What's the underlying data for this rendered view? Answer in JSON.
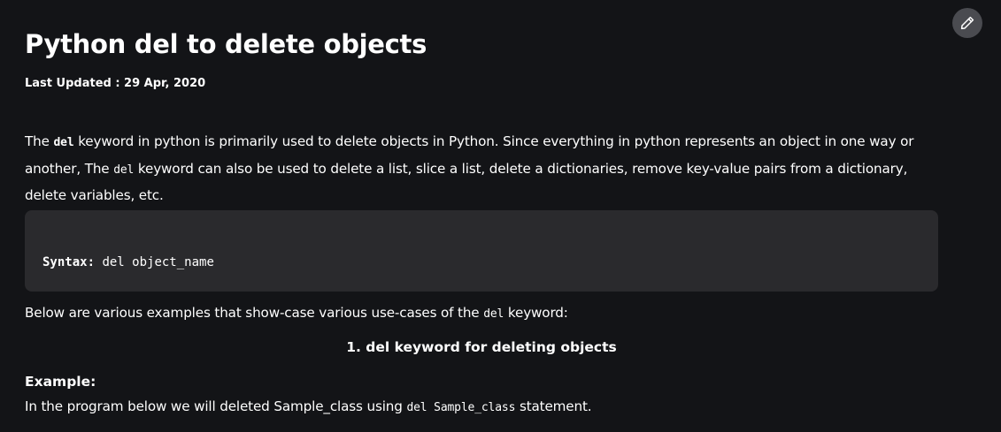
{
  "article": {
    "title": "Python del to delete objects",
    "last_updated": "Last Updated : 29 Apr, 2020",
    "intro": {
      "p1": "The ",
      "kw1": "del",
      "p2": " keyword in python is primarily used to delete objects in Python. Since everything in python represents an object in one way or another, The ",
      "kw2": "del",
      "p3": " keyword can also be used to delete a list, slice a list, delete a dictionaries, remove key-value pairs from a dictionary, delete variables, etc."
    },
    "syntax": {
      "label": "Syntax:",
      "code": " del object_name"
    },
    "below": {
      "p1": "Below are various examples that show-case various use-cases of the ",
      "kw": "del",
      "p2": " keyword:"
    },
    "section_heading": "1. del keyword for deleting objects",
    "example_label": "Example:",
    "example_text": {
      "p1": "In the program below we will deleted Sample_class using ",
      "kw": "del Sample_class",
      "p2": " statement."
    }
  },
  "toolbar": {
    "edit_icon": "pencil-icon"
  },
  "colors": {
    "background": "#131417",
    "code_background": "#2a2a2d",
    "edit_button": "#4a4b50",
    "text": "#ffffff"
  }
}
